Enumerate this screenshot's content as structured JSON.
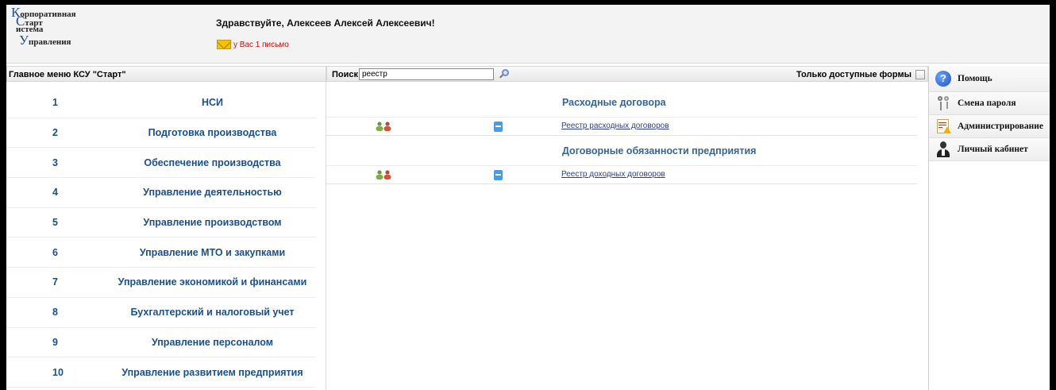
{
  "header": {
    "logo": {
      "line1_cap": "К",
      "line1_rest": "орпоративная",
      "line2_cap": "С",
      "line2_rest": "тарт",
      "line3_rest": "истема",
      "line4_cap": "У",
      "line4_rest": "правления"
    },
    "greeting": "Здравствуйте, Алексеев Алексей Алексеевич!",
    "mail_text": "у Вас 1 письмо"
  },
  "menu": {
    "title": "Главное меню КСУ \"Старт\"",
    "items": [
      {
        "num": "1",
        "label": "НСИ"
      },
      {
        "num": "2",
        "label": "Подготовка производства"
      },
      {
        "num": "3",
        "label": "Обеспечение производства"
      },
      {
        "num": "4",
        "label": "Управление деятельностью"
      },
      {
        "num": "5",
        "label": "Управление производством"
      },
      {
        "num": "6",
        "label": "Управление МТО и закупками"
      },
      {
        "num": "7",
        "label": "Управление экономикой и финансами"
      },
      {
        "num": "8",
        "label": "Бухгалтерский и налоговый учет"
      },
      {
        "num": "9",
        "label": "Управление персоналом"
      },
      {
        "num": "10",
        "label": "Управление развитием предприятия"
      }
    ]
  },
  "search": {
    "label": "Поиск",
    "value": "реестр",
    "only_available_label": "Только доступные формы",
    "only_available_checked": false
  },
  "results": [
    {
      "group": "Расходные договора",
      "link": "Реестр расходных договоров"
    },
    {
      "group": "Договорные обязанности предприятия",
      "link": "Реестр доходных договоров"
    }
  ],
  "side": {
    "items": [
      {
        "label": "Помощь",
        "icon": "help-icon"
      },
      {
        "label": "Смена пароля",
        "icon": "keys-icon"
      },
      {
        "label": "Администрирование",
        "icon": "admin-document-icon"
      },
      {
        "label": "Личный кабинет",
        "icon": "user-icon"
      }
    ]
  },
  "colors": {
    "menu_text": "#1a4f8f",
    "group_text": "#336699",
    "mail_text": "#d01010"
  }
}
